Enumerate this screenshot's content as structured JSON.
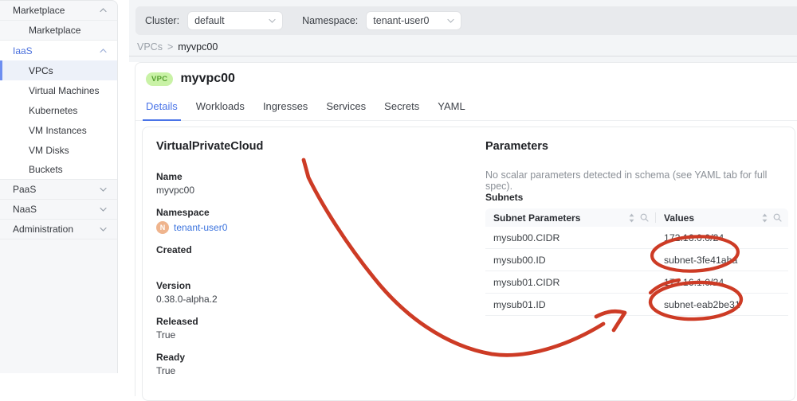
{
  "sidebar": {
    "groups": [
      {
        "label": "Marketplace",
        "state": "expanded",
        "items": [
          {
            "label": "Marketplace",
            "selected": false
          }
        ]
      },
      {
        "label": "IaaS",
        "state": "expanded",
        "items": [
          {
            "label": "VPCs",
            "selected": true
          },
          {
            "label": "Virtual Machines",
            "selected": false
          },
          {
            "label": "Kubernetes",
            "selected": false
          },
          {
            "label": "VM Instances",
            "selected": false
          },
          {
            "label": "VM Disks",
            "selected": false
          },
          {
            "label": "Buckets",
            "selected": false
          }
        ]
      },
      {
        "label": "PaaS",
        "state": "collapsed",
        "items": []
      },
      {
        "label": "NaaS",
        "state": "collapsed",
        "items": []
      },
      {
        "label": "Administration",
        "state": "collapsed",
        "items": []
      }
    ]
  },
  "topbar": {
    "cluster_label": "Cluster:",
    "cluster_value": "default",
    "namespace_label": "Namespace:",
    "namespace_value": "tenant-user0"
  },
  "breadcrumb": {
    "section": "VPCs",
    "separator": ">",
    "current": "myvpc00"
  },
  "page_header": {
    "badge": "VPC",
    "title": "myvpc00"
  },
  "tabs": [
    {
      "label": "Details",
      "active": true
    },
    {
      "label": "Workloads",
      "active": false
    },
    {
      "label": "Ingresses",
      "active": false
    },
    {
      "label": "Services",
      "active": false
    },
    {
      "label": "Secrets",
      "active": false
    },
    {
      "label": "YAML",
      "active": false
    }
  ],
  "details": {
    "heading": "VirtualPrivateCloud",
    "fields": [
      {
        "label": "Name",
        "value": "myvpc00"
      },
      {
        "label": "Namespace",
        "value": "tenant-user0",
        "avatar": "N"
      },
      {
        "label": "Created",
        "value": ""
      },
      {
        "label": "Version",
        "value": "0.38.0-alpha.2"
      },
      {
        "label": "Released",
        "value": "True"
      },
      {
        "label": "Ready",
        "value": "True"
      }
    ]
  },
  "parameters": {
    "heading": "Parameters",
    "note": "No scalar parameters detected in schema (see YAML tab for full spec).",
    "subnets_label": "Subnets",
    "table": {
      "columns": [
        "Subnet Parameters",
        "Values"
      ],
      "rows": [
        {
          "param": "mysub00.CIDR",
          "value": "172.16.0.0/24",
          "annotated": false
        },
        {
          "param": "mysub00.ID",
          "value": "subnet-3fe41aba",
          "annotated": true
        },
        {
          "param": "mysub01.CIDR",
          "value": "172.16.1.0/24",
          "annotated": false
        },
        {
          "param": "mysub01.ID",
          "value": "subnet-eab2be31",
          "annotated": true
        }
      ]
    }
  },
  "annotation": {
    "color": "#cd3b25",
    "description": "Hand-drawn red arrow pointing to red circles around the two subnet ID values"
  },
  "colors": {
    "accent_blue": "#4a74e8",
    "link_blue": "#3b73de",
    "badge_green_bg": "#c9f2a6",
    "badge_green_text": "#55a030",
    "annotation_red": "#cd3b25",
    "selected_item_bar": "#6d8ef0"
  }
}
